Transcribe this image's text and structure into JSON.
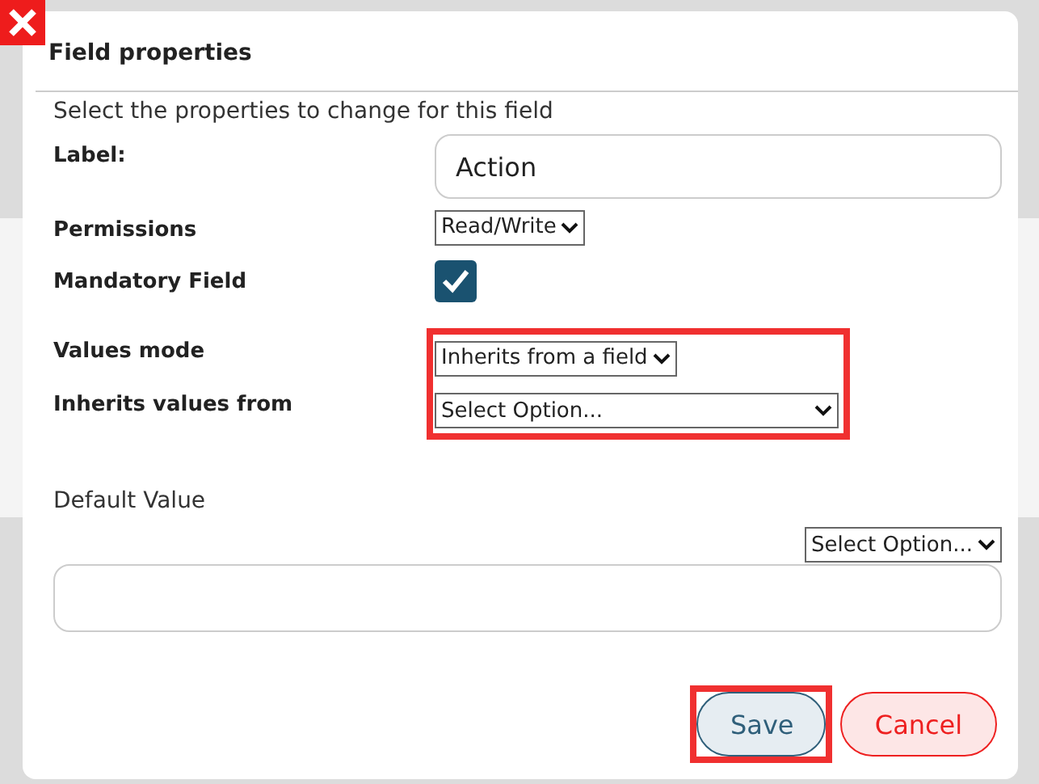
{
  "dialog": {
    "title": "Field properties",
    "subtitle": "Select the properties to change for this field"
  },
  "fields": [
    {
      "kind": "text",
      "label": "Label:",
      "value": "Action"
    },
    {
      "kind": "select",
      "label": "Permissions",
      "value": "Read/Write"
    },
    {
      "kind": "checkbox",
      "label": "Mandatory Field",
      "checked": true
    }
  ],
  "highlighted_fields": [
    {
      "kind": "select",
      "label": "Values mode",
      "value": "Inherits from a field"
    },
    {
      "kind": "select-wide",
      "label": "Inherits values from",
      "value": "Select Option..."
    }
  ],
  "default_value": {
    "label": "Default Value",
    "select": "Select Option..."
  },
  "buttons": [
    {
      "kind": "save",
      "label": "Save",
      "highlighted": true
    },
    {
      "kind": "cancel",
      "label": "Cancel",
      "highlighted": false
    }
  ]
}
